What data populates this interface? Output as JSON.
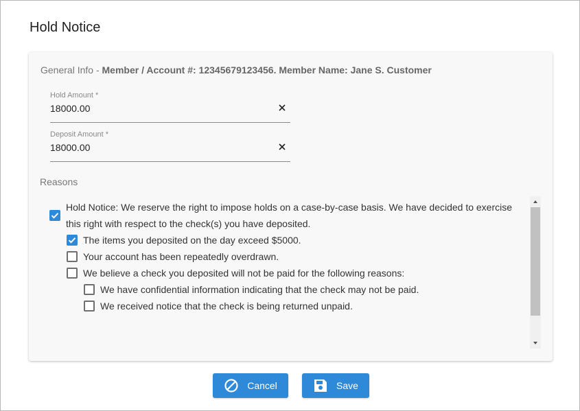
{
  "dialog": {
    "title": "Hold Notice"
  },
  "general_info": {
    "prefix": "General Info - ",
    "details": "Member / Account #: 12345679123456. Member Name: Jane S. Customer"
  },
  "fields": {
    "hold_amount": {
      "label": "Hold Amount *",
      "value": "18000.00"
    },
    "deposit_amount": {
      "label": "Deposit Amount *",
      "value": "18000.00"
    }
  },
  "reasons": {
    "label": "Reasons",
    "items": [
      {
        "text_line1": "Hold Notice: We reserve the right to impose holds on a case-by-case basis. We have decided to exercise",
        "text_line2": "this right with respect to the check(s) you have deposited.",
        "checked": true
      },
      {
        "text": "The items you deposited on the day exceed $5000.",
        "checked": true
      },
      {
        "text": "Your account has been repeatedly overdrawn.",
        "checked": false
      },
      {
        "text": "We believe a check you deposited will not be paid for the following reasons:",
        "checked": false
      },
      {
        "text": "We have confidential information indicating that the check may not be paid.",
        "checked": false
      },
      {
        "text": "We received notice that the check is being returned unpaid.",
        "checked": false
      }
    ]
  },
  "buttons": {
    "cancel": "Cancel",
    "save": "Save"
  },
  "colors": {
    "accent": "#2e8ad8",
    "card_bg": "#f8f8f8"
  }
}
